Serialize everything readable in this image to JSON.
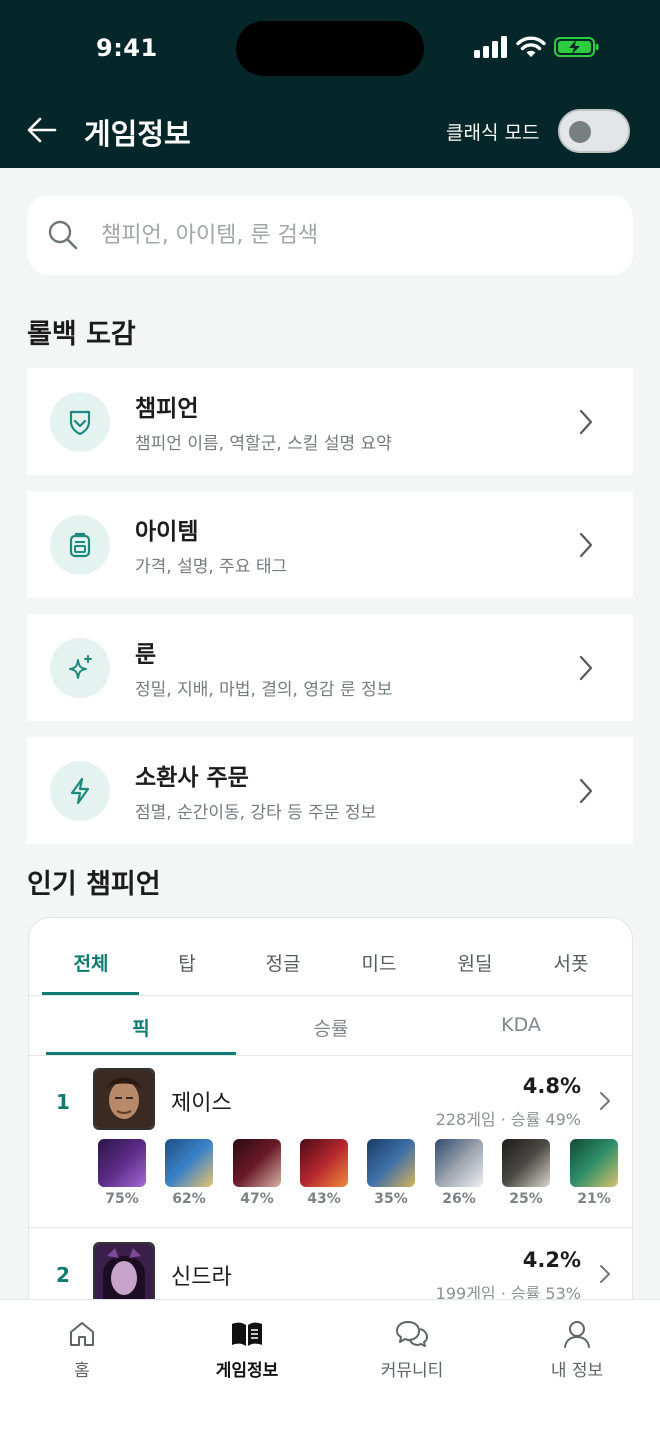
{
  "status_bar": {
    "time": "9:41"
  },
  "header": {
    "title": "게임정보",
    "classic_mode_label": "클래식 모드",
    "classic_mode_on": false
  },
  "search": {
    "placeholder": "챔피언, 아이템, 룬 검색"
  },
  "encyclopedia": {
    "title": "롤백 도감",
    "cards": [
      {
        "title": "챔피언",
        "subtitle": "챔피언 이름, 역할군, 스킬 설명 요약",
        "icon": "shield-icon"
      },
      {
        "title": "아이템",
        "subtitle": "가격, 설명, 주요 태그",
        "icon": "backpack-icon"
      },
      {
        "title": "룬",
        "subtitle": "정밀, 지배, 마법, 결의, 영감 룬 정보",
        "icon": "sparkles-icon"
      },
      {
        "title": "소환사 주문",
        "subtitle": "점멸, 순간이동, 강타 등 주문 정보",
        "icon": "lightning-icon"
      }
    ]
  },
  "popular": {
    "title": "인기 챔피언",
    "position_tabs": [
      "전체",
      "탑",
      "정글",
      "미드",
      "원딜",
      "서폿"
    ],
    "active_position": "전체",
    "sort_tabs": [
      "픽",
      "승률",
      "KDA"
    ],
    "active_sort": "픽",
    "champions": [
      {
        "rank": "1",
        "name": "제이스",
        "pick_rate": "4.8%",
        "meta": "228게임 · 승률 49%",
        "items": [
          {
            "rate": "75%",
            "color": "#5b2b86"
          },
          {
            "rate": "62%",
            "color": "#3c82c8"
          },
          {
            "rate": "47%",
            "color": "#6b1a28"
          },
          {
            "rate": "43%",
            "color": "#b3262e"
          },
          {
            "rate": "35%",
            "color": "#3d6fa8"
          },
          {
            "rate": "26%",
            "color": "#9aa2ad"
          },
          {
            "rate": "25%",
            "color": "#4d4b46"
          },
          {
            "rate": "21%",
            "color": "#2f8f6a"
          }
        ]
      },
      {
        "rank": "2",
        "name": "신드라",
        "pick_rate": "4.2%",
        "meta": "199게임 · 승률 53%"
      }
    ]
  },
  "bottom_nav": {
    "items": [
      {
        "label": "홈",
        "icon": "home-icon"
      },
      {
        "label": "게임정보",
        "icon": "book-icon"
      },
      {
        "label": "커뮤니티",
        "icon": "chat-icon"
      },
      {
        "label": "내 정보",
        "icon": "user-icon"
      }
    ],
    "active": "게임정보"
  },
  "colors": {
    "accent": "#0e7a70",
    "header_bg": "#06272a",
    "icon_circle": "#e4f3f0"
  }
}
